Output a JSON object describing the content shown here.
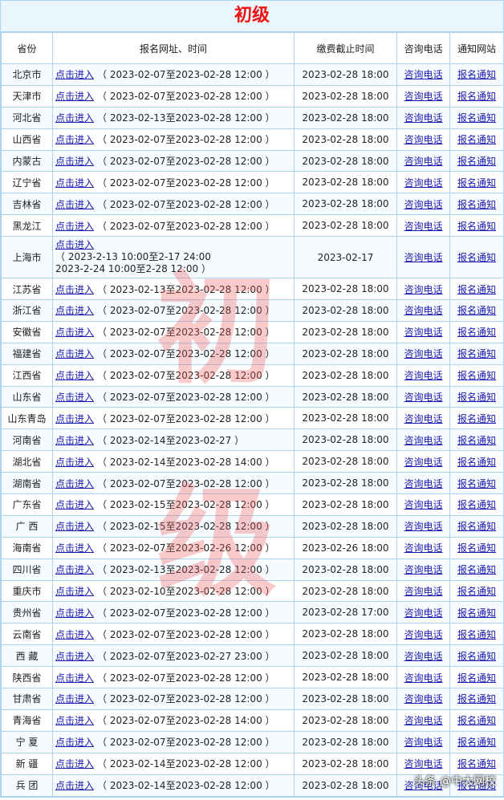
{
  "title": "初级",
  "headers": [
    "省份",
    "报名网址、时间",
    "缴费截止时间",
    "咨询电话",
    "通知网站"
  ],
  "link_text": "点击进入",
  "phone_text": "咨询电话",
  "notice_text": "报名通知",
  "watermark": [
    "初",
    "级"
  ],
  "signature": "头条 @中大网校",
  "rows": [
    {
      "province": "北京市",
      "period": "（ 2023-02-07至2023-02-28 12:00 ）",
      "deadline": "2023-02-28 18:00"
    },
    {
      "province": "天津市",
      "period": "（ 2023-02-07至2023-02-28 12:00 ）",
      "deadline": "2023-02-28 18:00"
    },
    {
      "province": "河北省",
      "period": "（ 2023-02-13至2023-02-28 12:00 ）",
      "deadline": "2023-02-28 18:00"
    },
    {
      "province": "山西省",
      "period": "（ 2023-02-07至2023-02-28 12:00 ）",
      "deadline": "2023-02-28 18:00"
    },
    {
      "province": "内蒙古",
      "period": "（ 2023-02-07至2023-02-28 12:00 ）",
      "deadline": "2023-02-28 18:00"
    },
    {
      "province": "辽宁省",
      "period": "（ 2023-02-07至2023-02-28 12:00 ）",
      "deadline": "2023-02-28 18:00"
    },
    {
      "province": "吉林省",
      "period": "（ 2023-02-07至2023-02-28 12:00 ）",
      "deadline": "2023-02-28 18:00"
    },
    {
      "province": "黑龙江",
      "period": "（ 2023-02-07至2023-02-28 12:00 ）",
      "deadline": "2023-02-28 18:00"
    },
    {
      "province": "上海市",
      "period_lines": [
        "（ 2023-2-13 10:00至2-17 24:00",
        "2023-2-24 10:00至2-28 12:00 ）"
      ],
      "deadline": "2023-02-17"
    },
    {
      "province": "江苏省",
      "period": "（ 2023-02-13至2023-02-28 12:00 ）",
      "deadline": "2023-02-28 18:00"
    },
    {
      "province": "浙江省",
      "period": "（ 2023-02-07至2023-02-28 12:00 ）",
      "deadline": "2023-02-28 18:00"
    },
    {
      "province": "安徽省",
      "period": "（ 2023-02-07至2023-02-28 12:00 ）",
      "deadline": "2023-02-28 18:00"
    },
    {
      "province": "福建省",
      "period": "（ 2023-02-07至2023-02-28 12:00 ）",
      "deadline": "2023-02-28 18:00"
    },
    {
      "province": "江西省",
      "period": "（ 2023-02-07至2023-02-28 12:00 ）",
      "deadline": "2023-02-28 18:00"
    },
    {
      "province": "山东省",
      "period": "（ 2023-02-07至2023-02-28 12:00 ）",
      "deadline": "2023-02-28 18:00"
    },
    {
      "province": "山东青岛",
      "period": "（ 2023-02-07至2023-02-28 12:00 ）",
      "deadline": "2023-02-28 18:00"
    },
    {
      "province": "河南省",
      "period": "（ 2023-02-14至2023-02-27 ）",
      "deadline": "2023-02-28 18:00"
    },
    {
      "province": "湖北省",
      "period": "（ 2023-02-14至2023-02-28 14:00 ）",
      "deadline": "2023-02-28 18:00"
    },
    {
      "province": "湖南省",
      "period": "（ 2023-02-07至2023-02-28 12:00 ）",
      "deadline": "2023-02-28 18:00"
    },
    {
      "province": "广东省",
      "period": "（ 2023-02-15至2023-02-28 12:00 ）",
      "deadline": "2023-02-28 18:00"
    },
    {
      "province": "广 西",
      "period": "（ 2023-02-15至2023-02-28 12:00 ）",
      "deadline": "2023-02-28 18:00"
    },
    {
      "province": "海南省",
      "period": "（ 2023-02-07至2023-02-26 12:00 ）",
      "deadline": "2023-02-26 18:00"
    },
    {
      "province": "四川省",
      "period": "（ 2023-02-13至2023-02-28 12:00 ）",
      "deadline": "2023-02-28 18:00"
    },
    {
      "province": "重庆市",
      "period": "（ 2023-02-10至2023-02-28 12:00 ）",
      "deadline": "2023-02-28 18:00"
    },
    {
      "province": "贵州省",
      "period": "（ 2023-02-07至2023-02-28 12:00 ）",
      "deadline": "2023-02-28 17:00"
    },
    {
      "province": "云南省",
      "period": "（ 2023-02-07至2023-02-28 12:00 ）",
      "deadline": "2023-02-28 18:00"
    },
    {
      "province": "西 藏",
      "period": "（ 2023-02-07至2023-02-27 23:00 ）",
      "deadline": "2023-02-28 18:00"
    },
    {
      "province": "陕西省",
      "period": "（ 2023-02-07至2023-02-28 12:00 ）",
      "deadline": "2023-02-28 18:00"
    },
    {
      "province": "甘肃省",
      "period": "（ 2023-02-07至2023-02-28 12:00 ）",
      "deadline": "2023-02-28 18:00"
    },
    {
      "province": "青海省",
      "period": "（ 2023-02-07至2023-02-28 14:00 ）",
      "deadline": "2023-02-28 18:00"
    },
    {
      "province": "宁 夏",
      "period": "（ 2023-02-07至2023-02-28 12:00 ）",
      "deadline": "2023-02-28 18:00"
    },
    {
      "province": "新 疆",
      "period": "（ 2023-02-14至2023-02-28 12:00 ）",
      "deadline": "2023-02-28 18:00"
    },
    {
      "province": "兵 团",
      "period": "（ 2023-02-14至2023-02-28 12:00 ）",
      "deadline": "2023-02-28 18:00"
    }
  ]
}
